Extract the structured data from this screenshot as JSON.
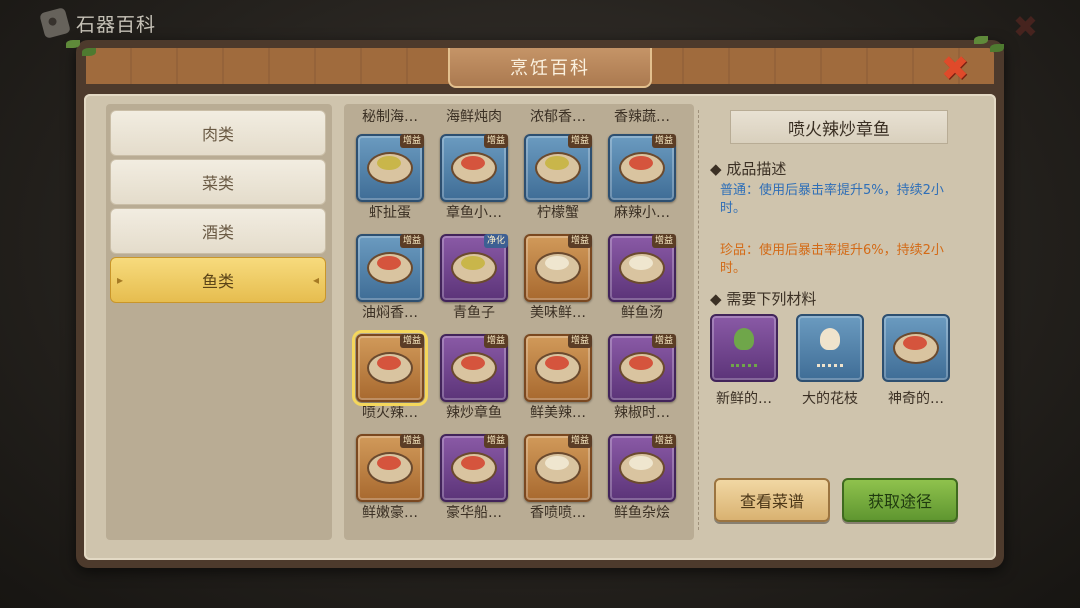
{
  "top_bar": {
    "title": "石器百科"
  },
  "window": {
    "title": "烹饪百科"
  },
  "categories": [
    {
      "label": "肉类"
    },
    {
      "label": "菜类"
    },
    {
      "label": "酒类"
    },
    {
      "label": "鱼类",
      "active": true
    }
  ],
  "foods": [
    {
      "name": "秘制海…",
      "icon": "dish-icon",
      "rarity": "none"
    },
    {
      "name": "海鲜炖肉",
      "icon": "dish-icon",
      "rarity": "none"
    },
    {
      "name": "浓郁香…",
      "icon": "dish-icon",
      "rarity": "none"
    },
    {
      "name": "香辣蔬…",
      "icon": "dish-icon",
      "rarity": "none"
    },
    {
      "name": "虾扯蛋",
      "icon": "shrimp-egg-icon",
      "rarity": "blue",
      "badge": "增益"
    },
    {
      "name": "章鱼小…",
      "icon": "octopus-ball-icon",
      "rarity": "blue",
      "badge": "增益"
    },
    {
      "name": "柠檬蟹",
      "icon": "lemon-crab-icon",
      "rarity": "blue",
      "badge": "增益"
    },
    {
      "name": "麻辣小…",
      "icon": "spicy-crayfish-icon",
      "rarity": "blue",
      "badge": "增益"
    },
    {
      "name": "油焖香…",
      "icon": "braised-crab-icon",
      "rarity": "blue",
      "badge": "增益"
    },
    {
      "name": "青鱼子",
      "icon": "fish-roe-icon",
      "rarity": "purple",
      "badge": "净化"
    },
    {
      "name": "美味鲜…",
      "icon": "fish-soup-icon",
      "rarity": "orange",
      "badge": "增益"
    },
    {
      "name": "鲜鱼汤",
      "icon": "fish-soup-icon",
      "rarity": "purple",
      "badge": "增益"
    },
    {
      "name": "喷火辣…",
      "icon": "octopus-stirfry-icon",
      "rarity": "orange",
      "badge": "增益",
      "selected": true
    },
    {
      "name": "辣炒章鱼",
      "icon": "octopus-stirfry-icon",
      "rarity": "purple",
      "badge": "增益"
    },
    {
      "name": "鲜美辣…",
      "icon": "spicy-fish-icon",
      "rarity": "orange",
      "badge": "增益"
    },
    {
      "name": "辣椒时…",
      "icon": "spicy-fish-icon",
      "rarity": "purple",
      "badge": "增益"
    },
    {
      "name": "鲜嫩豪…",
      "icon": "fish-platter-icon",
      "rarity": "orange",
      "badge": "增益"
    },
    {
      "name": "豪华船…",
      "icon": "fish-platter-icon",
      "rarity": "purple",
      "badge": "增益"
    },
    {
      "name": "香喷喷…",
      "icon": "stew-icon",
      "rarity": "orange",
      "badge": "增益"
    },
    {
      "name": "鲜鱼杂烩",
      "icon": "stew-icon",
      "rarity": "purple",
      "badge": "增益"
    }
  ],
  "detail": {
    "title": "喷火辣炒章鱼",
    "desc_header": "成品描述",
    "normal_desc": "普通：使用后暴击率提升5%，持续2小时。",
    "rare_desc": "珍品：使用后暴击率提升6%，持续2小时。",
    "materials_header": "需要下列材料",
    "materials": [
      {
        "name": "新鲜的…",
        "icon": "green-squid-icon",
        "rarity": "purple"
      },
      {
        "name": "大的花枝",
        "icon": "white-squid-icon",
        "rarity": "blue"
      },
      {
        "name": "神奇的…",
        "icon": "seasoning-bowl-icon",
        "rarity": "blue"
      }
    ],
    "view_recipe": "查看菜谱",
    "obtain_route": "获取途径"
  },
  "colors": {
    "normal_text": "#2e6fb8",
    "rare_text": "#d46a15",
    "active_category": "#e6bd4f"
  }
}
